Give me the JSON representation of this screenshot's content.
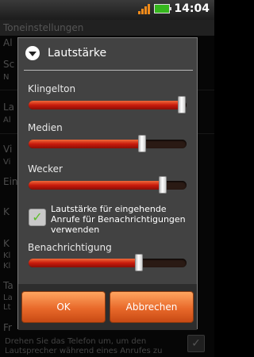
{
  "status_bar": {
    "time": "14:04",
    "icons": [
      "signal-icon",
      "battery-icon"
    ],
    "signal_color": "#f08a1a",
    "battery_color": "#35b71d"
  },
  "background": {
    "title": "Toneinstellungen",
    "rows": [
      "Al",
      "Sc",
      "N",
      "La",
      "Al",
      "Vi",
      "Vi",
      "Ein",
      "K",
      "K",
      "Kl",
      "Kl",
      "Ta",
      "La",
      "Lt",
      "Fr"
    ],
    "footer_text": "Drehen Sie das Telefon um, um den Lautsprecher während eines Anrufes zu",
    "footer_checkbox_checked": true
  },
  "dialog": {
    "title": "Lautstärke",
    "icon": "chevron-down-icon",
    "sliders": [
      {
        "label": "Klingelton",
        "level": 0.97
      },
      {
        "label": "Medien",
        "level": 0.72
      },
      {
        "label": "Wecker",
        "level": 0.85
      },
      {
        "label": "Benachrichtigung",
        "level": 0.7
      }
    ],
    "checkbox": {
      "label": "Lautstärke für eingehende Anrufe für Benachrichtigungen verwenden",
      "checked": true
    },
    "ok_label": "OK",
    "cancel_label": "Abbrechen",
    "accent_color": "#c81a0c"
  }
}
